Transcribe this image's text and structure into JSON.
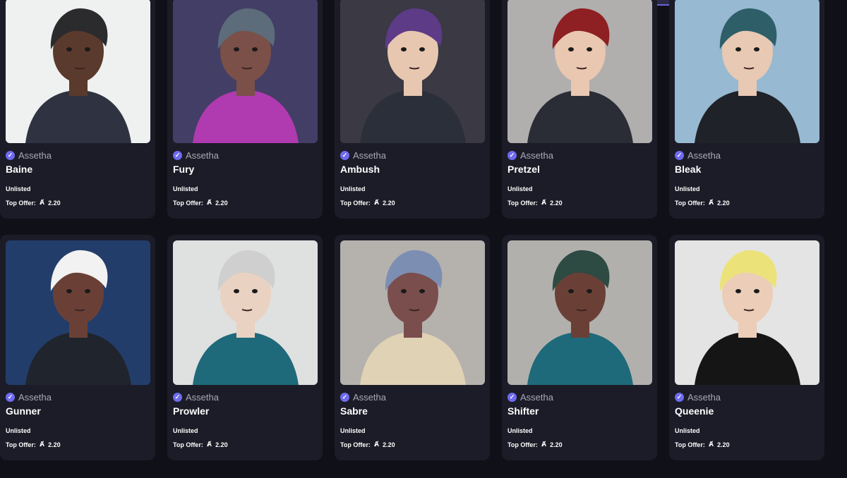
{
  "cards": [
    {
      "name": "Baine",
      "creator": "Assetha",
      "status": "Unlisted",
      "offer_label": "Top Offer:",
      "price": "2.20",
      "colors": {
        "bg": "#eef1ef",
        "hair": "#2b2b2e",
        "skin": "#5a3a2c",
        "shirt": "#2f3240"
      }
    },
    {
      "name": "Fury",
      "creator": "Assetha",
      "status": "Unlisted",
      "offer_label": "Top Offer:",
      "price": "2.20",
      "colors": {
        "bg": "#433e66",
        "hair": "#5c6c7a",
        "skin": "#7a5048",
        "shirt": "#b03ab0"
      }
    },
    {
      "name": "Ambush",
      "creator": "Assetha",
      "status": "Unlisted",
      "offer_label": "Top Offer:",
      "price": "2.20",
      "colors": {
        "bg": "#3a3944",
        "hair": "#5d3b86",
        "skin": "#e7c7b0",
        "shirt": "#2b2f3a"
      }
    },
    {
      "name": "Pretzel",
      "creator": "Assetha",
      "status": "Unlisted",
      "offer_label": "Top Offer:",
      "price": "2.20",
      "colors": {
        "bg": "#b1aeae",
        "hair": "#8e1f22",
        "skin": "#e9c7b1",
        "shirt": "#2a2d35"
      }
    },
    {
      "name": "Bleak",
      "creator": "Assetha",
      "status": "Unlisted",
      "offer_label": "Top Offer:",
      "price": "2.20",
      "colors": {
        "bg": "#97b9d2",
        "hair": "#2e5f69",
        "skin": "#e8c9b4",
        "shirt": "#1f2228"
      }
    },
    {
      "name": "Gunner",
      "creator": "Assetha",
      "status": "Unlisted",
      "offer_label": "Top Offer:",
      "price": "2.20",
      "colors": {
        "bg": "#233d6b",
        "hair": "#f2f2f2",
        "skin": "#6a4036",
        "shirt": "#20242c"
      }
    },
    {
      "name": "Prowler",
      "creator": "Assetha",
      "status": "Unlisted",
      "offer_label": "Top Offer:",
      "price": "2.20",
      "colors": {
        "bg": "#dfe0e0",
        "hair": "#cfcfcf",
        "skin": "#ead2c2",
        "shirt": "#1f6a7a"
      }
    },
    {
      "name": "Sabre",
      "creator": "Assetha",
      "status": "Unlisted",
      "offer_label": "Top Offer:",
      "price": "2.20",
      "colors": {
        "bg": "#b5b1ad",
        "hair": "#7c8fb3",
        "skin": "#7a4e4d",
        "shirt": "#e0d2b4"
      }
    },
    {
      "name": "Shifter",
      "creator": "Assetha",
      "status": "Unlisted",
      "offer_label": "Top Offer:",
      "price": "2.20",
      "colors": {
        "bg": "#b2b0ac",
        "hair": "#2d4a43",
        "skin": "#6a4036",
        "shirt": "#1f6a7a"
      }
    },
    {
      "name": "Queenie",
      "creator": "Assetha",
      "status": "Unlisted",
      "offer_label": "Top Offer:",
      "price": "2.20",
      "colors": {
        "bg": "#e4e4e4",
        "hair": "#ece27a",
        "skin": "#ebcdb8",
        "shirt": "#151515"
      }
    }
  ],
  "icons": {
    "verified": "verified-check-icon",
    "currency": "algorand-icon"
  }
}
